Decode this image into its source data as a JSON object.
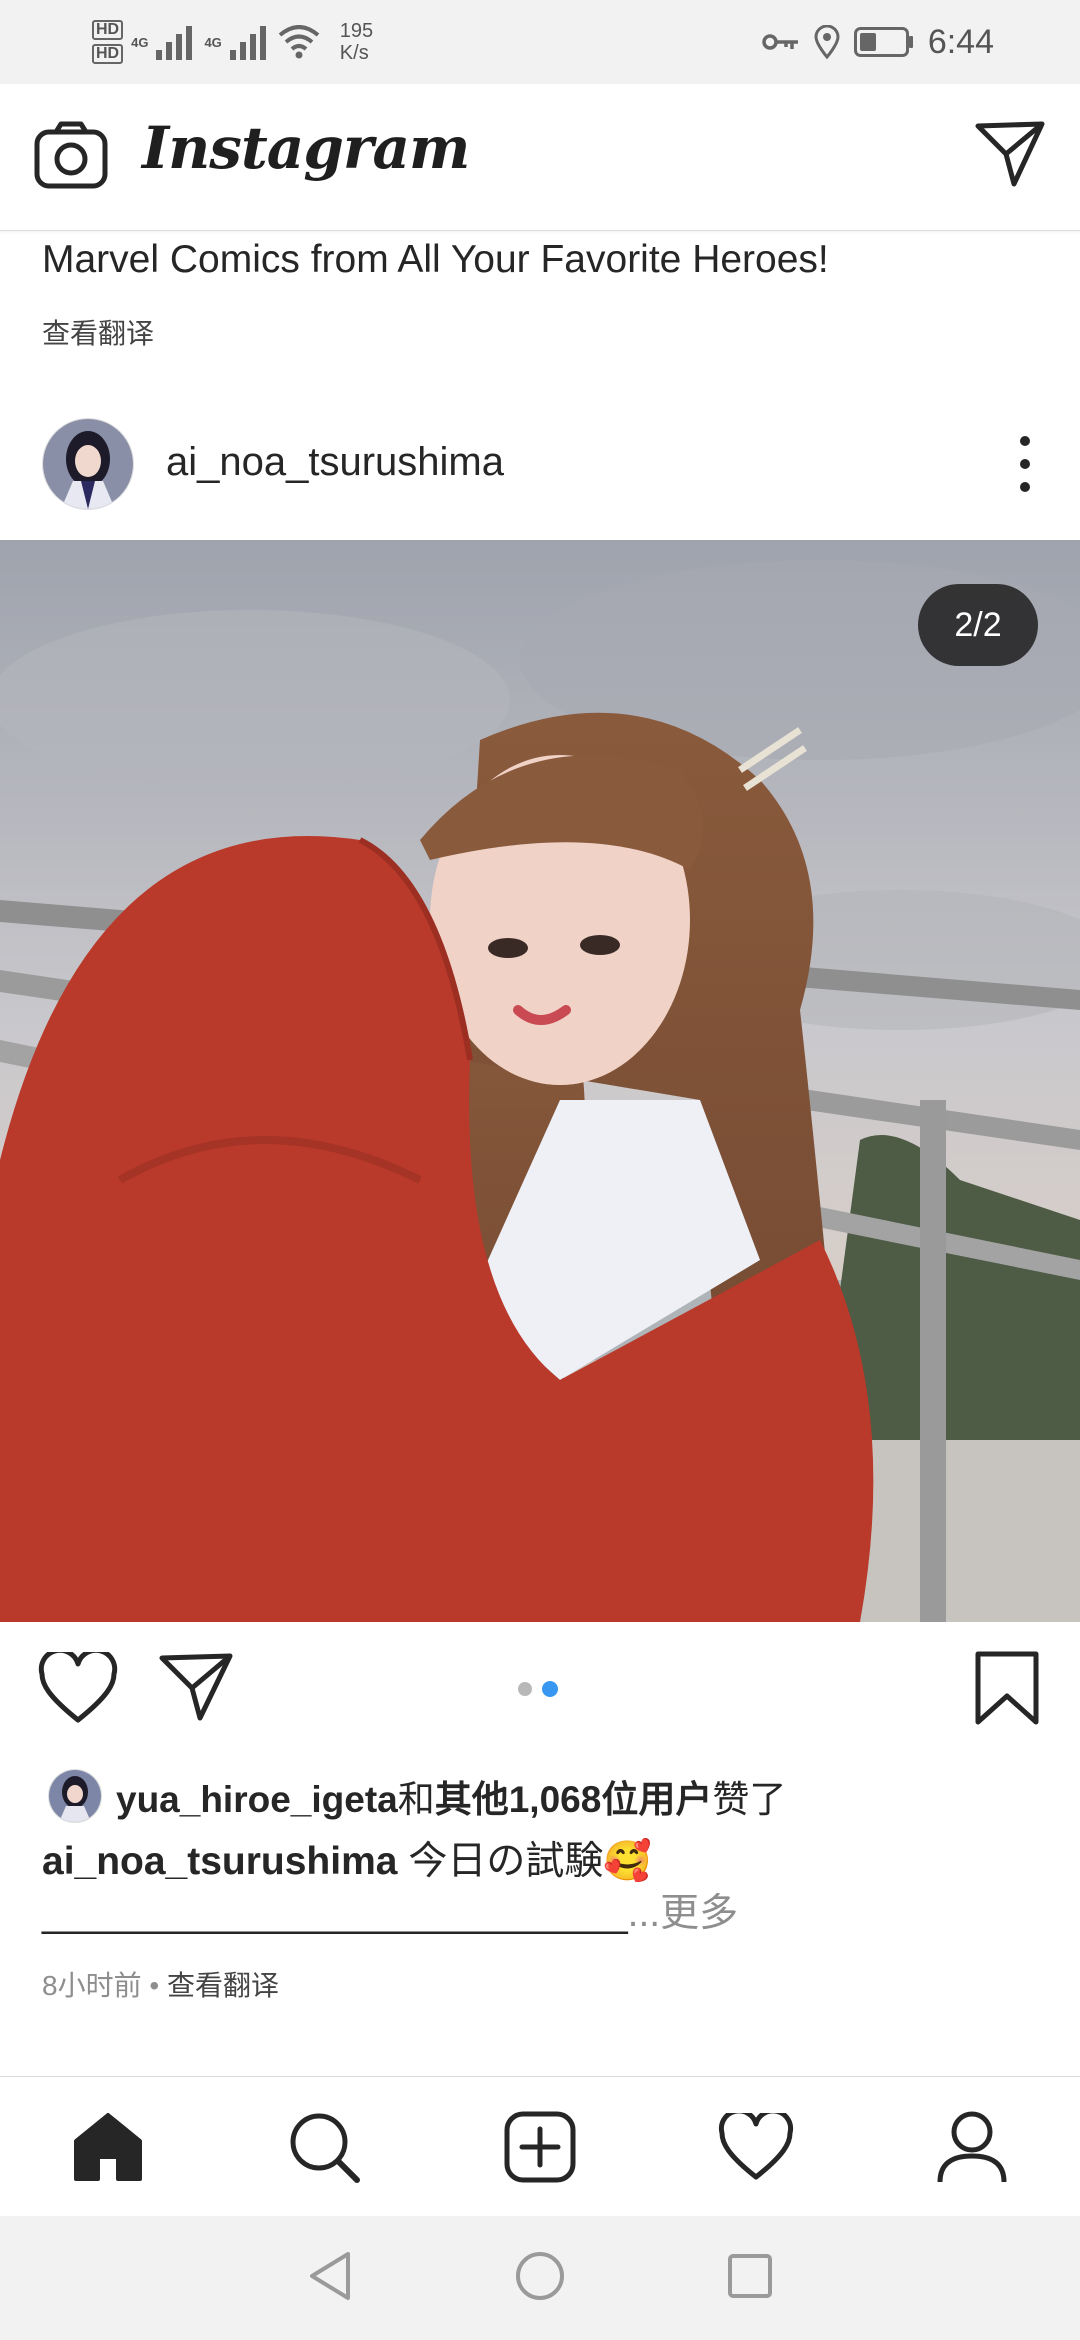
{
  "status_bar": {
    "hd1": "HD",
    "hd2": "HD",
    "net1": "4G",
    "net2": "4G",
    "speed_value": "195",
    "speed_unit": "K/s",
    "time": "6:44"
  },
  "header": {
    "app_title": "Instagram",
    "icons": [
      "camera-icon",
      "direct-message-icon"
    ]
  },
  "previous_post": {
    "caption_tail": "Marvel Comics from All Your Favorite Heroes!",
    "translate_label": "查看翻译"
  },
  "post": {
    "username": "ai_noa_tsurushima",
    "image_counter": "2/2",
    "carousel": {
      "count": 2,
      "active_index": 2
    },
    "likes": {
      "liker": "yua_hiroe_igeta",
      "and_text": "和",
      "others": "其他1,068位用户",
      "liked_text": "赞了"
    },
    "caption_user": "ai_noa_tsurushima",
    "caption_text": "今日の試験🥰",
    "caption_line2": "___________________________",
    "more_label": "...更多",
    "time_ago": "8小时前",
    "separator": " • ",
    "translate_label": "查看翻译"
  },
  "bottom_nav": {
    "items": [
      "home-icon",
      "search-icon",
      "new-post-icon",
      "activity-heart-icon",
      "profile-icon"
    ]
  },
  "colors": {
    "accent": "#3897f0",
    "text": "#262626",
    "muted": "#8e8e8e"
  }
}
